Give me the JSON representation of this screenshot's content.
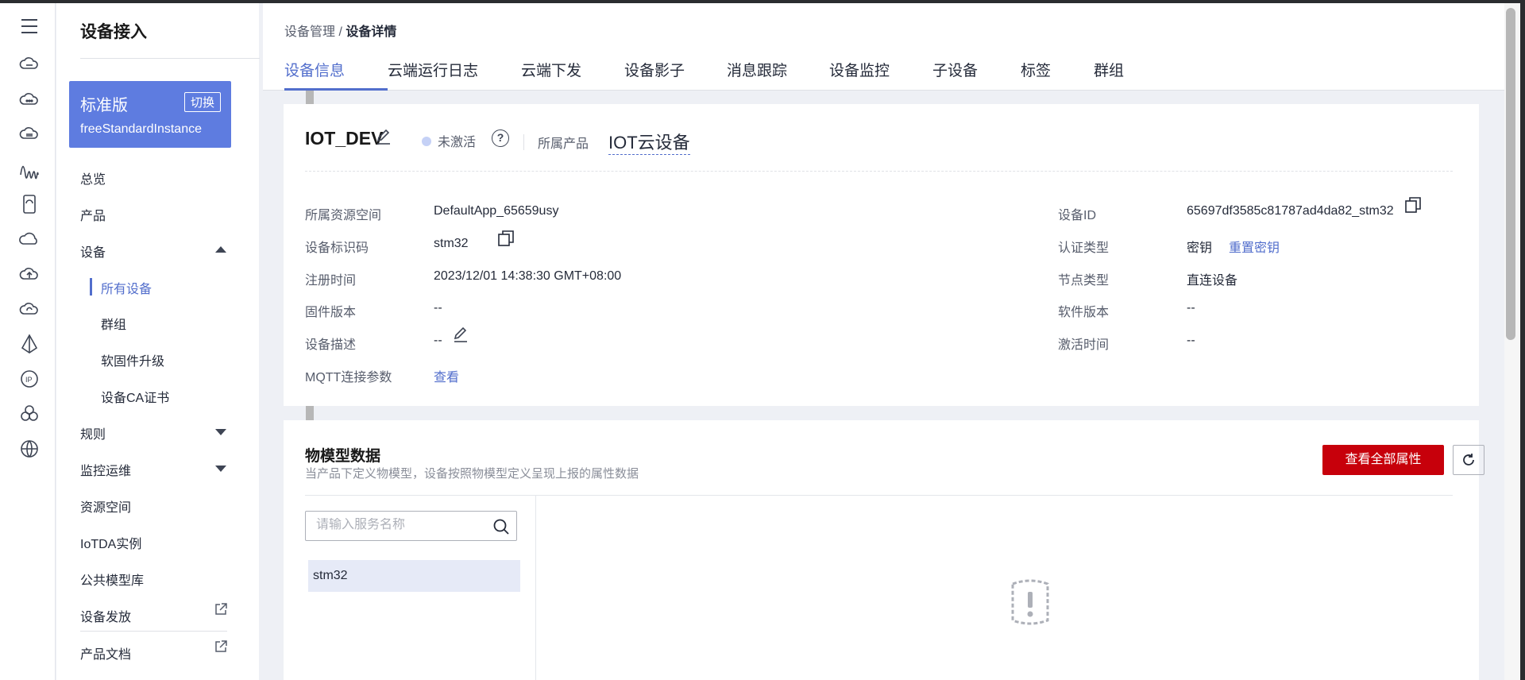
{
  "sidebar": {
    "title": "设备接入",
    "edition": {
      "name": "标准版",
      "switch_label": "切换",
      "instance": "freeStandardInstance"
    },
    "items": [
      {
        "label": "总览"
      },
      {
        "label": "产品"
      },
      {
        "label": "设备"
      },
      {
        "label": "规则"
      },
      {
        "label": "监控运维"
      },
      {
        "label": "资源空间"
      },
      {
        "label": "IoTDA实例"
      },
      {
        "label": "公共模型库"
      },
      {
        "label": "设备发放"
      },
      {
        "label": "产品文档"
      }
    ],
    "device_sub": [
      "所有设备",
      "群组",
      "软固件升级",
      "设备CA证书"
    ]
  },
  "rail_icons": [
    "menu-icon",
    "cloud-server-icon",
    "cloud-icon",
    "cloud-link-icon",
    "waveform-icon",
    "phone-icon",
    "cloud-outline-icon",
    "cloud-upload-icon",
    "cloud-sync-icon",
    "prism-icon",
    "ip-icon",
    "cluster-icon",
    "globe-icon"
  ],
  "breadcrumb": {
    "parent": "设备管理",
    "separator": " / ",
    "current": "设备详情"
  },
  "tabs": [
    "设备信息",
    "云端运行日志",
    "云端下发",
    "设备影子",
    "消息跟踪",
    "设备监控",
    "子设备",
    "标签",
    "群组"
  ],
  "device": {
    "name": "IOT_DEV",
    "status": "未激活",
    "product_label": "所属产品",
    "product": "IOT云设备",
    "fields_left": [
      {
        "label": "所属资源空间",
        "value": "DefaultApp_65659usy"
      },
      {
        "label": "设备标识码",
        "value": "stm32"
      },
      {
        "label": "注册时间",
        "value": "2023/12/01 14:38:30 GMT+08:00"
      },
      {
        "label": "固件版本",
        "value": "--"
      },
      {
        "label": "设备描述",
        "value": "--"
      },
      {
        "label": "MQTT连接参数",
        "value": "查看"
      }
    ],
    "fields_right": [
      {
        "label": "设备ID",
        "value": "65697df3585c81787ad4da82_stm32"
      },
      {
        "label": "认证类型",
        "value": "密钥",
        "action": "重置密钥"
      },
      {
        "label": "节点类型",
        "value": "直连设备"
      },
      {
        "label": "软件版本",
        "value": "--"
      },
      {
        "label": "激活时间",
        "value": "--"
      }
    ]
  },
  "model": {
    "title": "物模型数据",
    "subtitle": "当产品下定义物模型，设备按照物模型定义呈现上报的属性数据",
    "view_all": "查看全部属性",
    "search_placeholder": "请输入服务名称",
    "services": [
      "stm32"
    ]
  },
  "colors": {
    "accent": "#526ecc",
    "edition_bg": "#5e7ce0",
    "primary_button": "#c7000b"
  }
}
